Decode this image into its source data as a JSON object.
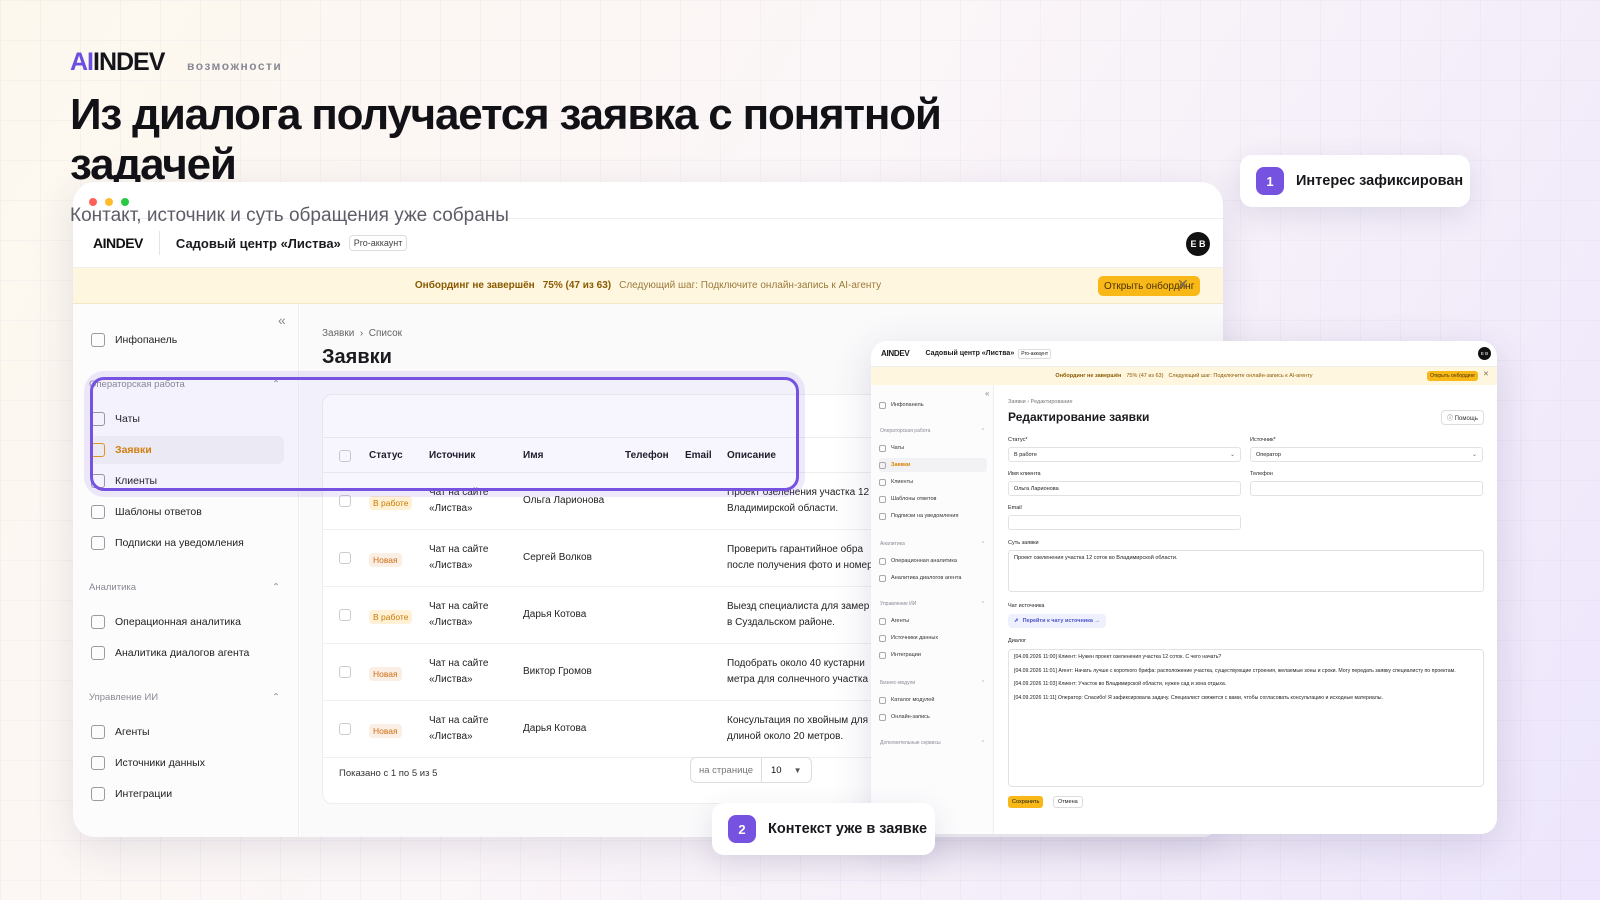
{
  "header": {
    "brand_ai": "AI",
    "brand_rest": "INDEV",
    "brand_sub": "возможности",
    "headline": "Из диалога получается заявка с понятной задачей",
    "subtitle": "Контакт, источник и суть обращения уже собраны"
  },
  "callouts": [
    {
      "number": "1",
      "label": "Интерес зафиксирован"
    },
    {
      "number": "2",
      "label": "Контекст уже в заявке"
    }
  ],
  "colors": {
    "accent": "#7552e0",
    "brand_orange": "#f7b818"
  },
  "app": {
    "logo": "AINDEV",
    "org": "Садовый центр «Листва»",
    "pro": "Pro-аккаунт",
    "avatar": "E B",
    "onboarding": {
      "title": "Онбординг не завершён",
      "progress": "75% (47 из 63)",
      "next": "Следующий шаг: Подключите онлайн-запись к AI-агенту",
      "button": "Открыть онбординг"
    },
    "sidebar": {
      "info": "Инфопанель",
      "sec_ops": "Операторская работа",
      "chats": "Чаты",
      "requests": "Заявки",
      "clients": "Клиенты",
      "templates": "Шаблоны ответов",
      "subs": "Подписки на уведомления",
      "sec_analytics": "Аналитика",
      "ops_an": "Операционная аналитика",
      "agent_an": "Аналитика диалогов агента",
      "sec_ai": "Управление ИИ",
      "agents": "Агенты",
      "sources": "Источники данных",
      "integrations": "Интеграции"
    },
    "crumbs": {
      "a": "Заявки",
      "b": "Список"
    },
    "page_title": "Заявки",
    "columns": {
      "status": "Статус",
      "source": "Источник",
      "name": "Имя",
      "phone": "Телефон",
      "email": "Email",
      "desc": "Описание"
    },
    "rows": [
      {
        "status": "В работе",
        "src1": "Чат на сайте",
        "src2": "«Листва»",
        "name": "Ольга Ларионова",
        "d1": "Проект озеленения участка 12",
        "d2": "Владимирской области."
      },
      {
        "status": "Новая",
        "src1": "Чат на сайте",
        "src2": "«Листва»",
        "name": "Сергей Волков",
        "d1": "Проверить гарантийное обра",
        "d2": "после получения фото и номер"
      },
      {
        "status": "В работе",
        "src1": "Чат на сайте",
        "src2": "«Листва»",
        "name": "Дарья Котова",
        "d1": "Выезд специалиста для замер",
        "d2": "в Суздальском районе."
      },
      {
        "status": "Новая",
        "src1": "Чат на сайте",
        "src2": "«Листва»",
        "name": "Виктор Громов",
        "d1": "Подобрать около 40 кустарни",
        "d2": "метра для солнечного участка"
      },
      {
        "status": "Новая",
        "src1": "Чат на сайте",
        "src2": "«Листва»",
        "name": "Дарья Котова",
        "d1": "Консультация по хвойным для",
        "d2": "длиной около 20 метров."
      }
    ],
    "footer": {
      "shown": "Показано с 1 по 5 из 5",
      "per_page": "на странице",
      "per_page_value": "10"
    }
  },
  "edit": {
    "logo": "AINDEV",
    "org": "Садовый центр «Листва»",
    "pro": "Pro-аккаунт",
    "avatar": "E B",
    "onb_title": "Онбординг не завершён",
    "onb_progress": "75% (47 из 63)",
    "onb_next": "Следующий шаг: Подключите онлайн-запись к AI-агенту",
    "onb_button": "Открыть онбординг",
    "sidebar": {
      "info": "Инфопанель",
      "sec_ops": "Операторская работа",
      "chats": "Чаты",
      "requests": "Заявки",
      "clients": "Клиенты",
      "templates": "Шаблоны ответов",
      "subs": "Подписки на уведомления",
      "sec_analytics": "Аналитика",
      "ops_an": "Операционная аналитика",
      "agent_an": "Аналитика диалогов агента",
      "sec_ai": "Управление ИИ",
      "agents": "Агенты",
      "sources": "Источники данных",
      "integrations": "Интеграции",
      "sec_biz": "Бизнес-модули",
      "catalog": "Каталог модулей",
      "booking": "Онлайн-запись",
      "sec_extra": "Дополнительные сервисы"
    },
    "crumb_a": "Заявки",
    "crumb_b": "Редактирование",
    "title": "Редактирование заявки",
    "help": "Помощь",
    "status_label": "Статус*",
    "status_value": "В работе",
    "source_label": "Источник*",
    "source_value": "Оператор",
    "client_label": "Имя клиента",
    "client_value": "Ольга Ларионова",
    "phone_label": "Телефон",
    "phone_value": "",
    "email_label": "Email",
    "email_value": "",
    "summary_label": "Суть заявки",
    "summary_value": "Проект озеленения участка 12 соток во Владимирской области.",
    "chat_label": "Чат источника",
    "chat_link": "Перейти к чату источника →",
    "dialog_label": "Диалог",
    "dialog": [
      "[04.09.2026 11:00] Клиент: Нужен проект озеленения участка 12 соток. С чего начать?",
      "[04.09.2026 11:01] Агент: Начать лучше с короткого брифа: расположение участка, существующие строения, желаемые зоны и сроки. Могу передать заявку специалисту по проектам.",
      "[04.09.2026 11:03] Клиент: Участок во Владимирской области, нужен сад и зона отдыха.",
      "[04.09.2026 11:11] Оператор: Спасибо! Я зафиксировала задачу. Специалист свяжется с вами, чтобы согласовать консультацию и исходные материалы."
    ],
    "save": "Сохранить",
    "cancel": "Отмена"
  }
}
